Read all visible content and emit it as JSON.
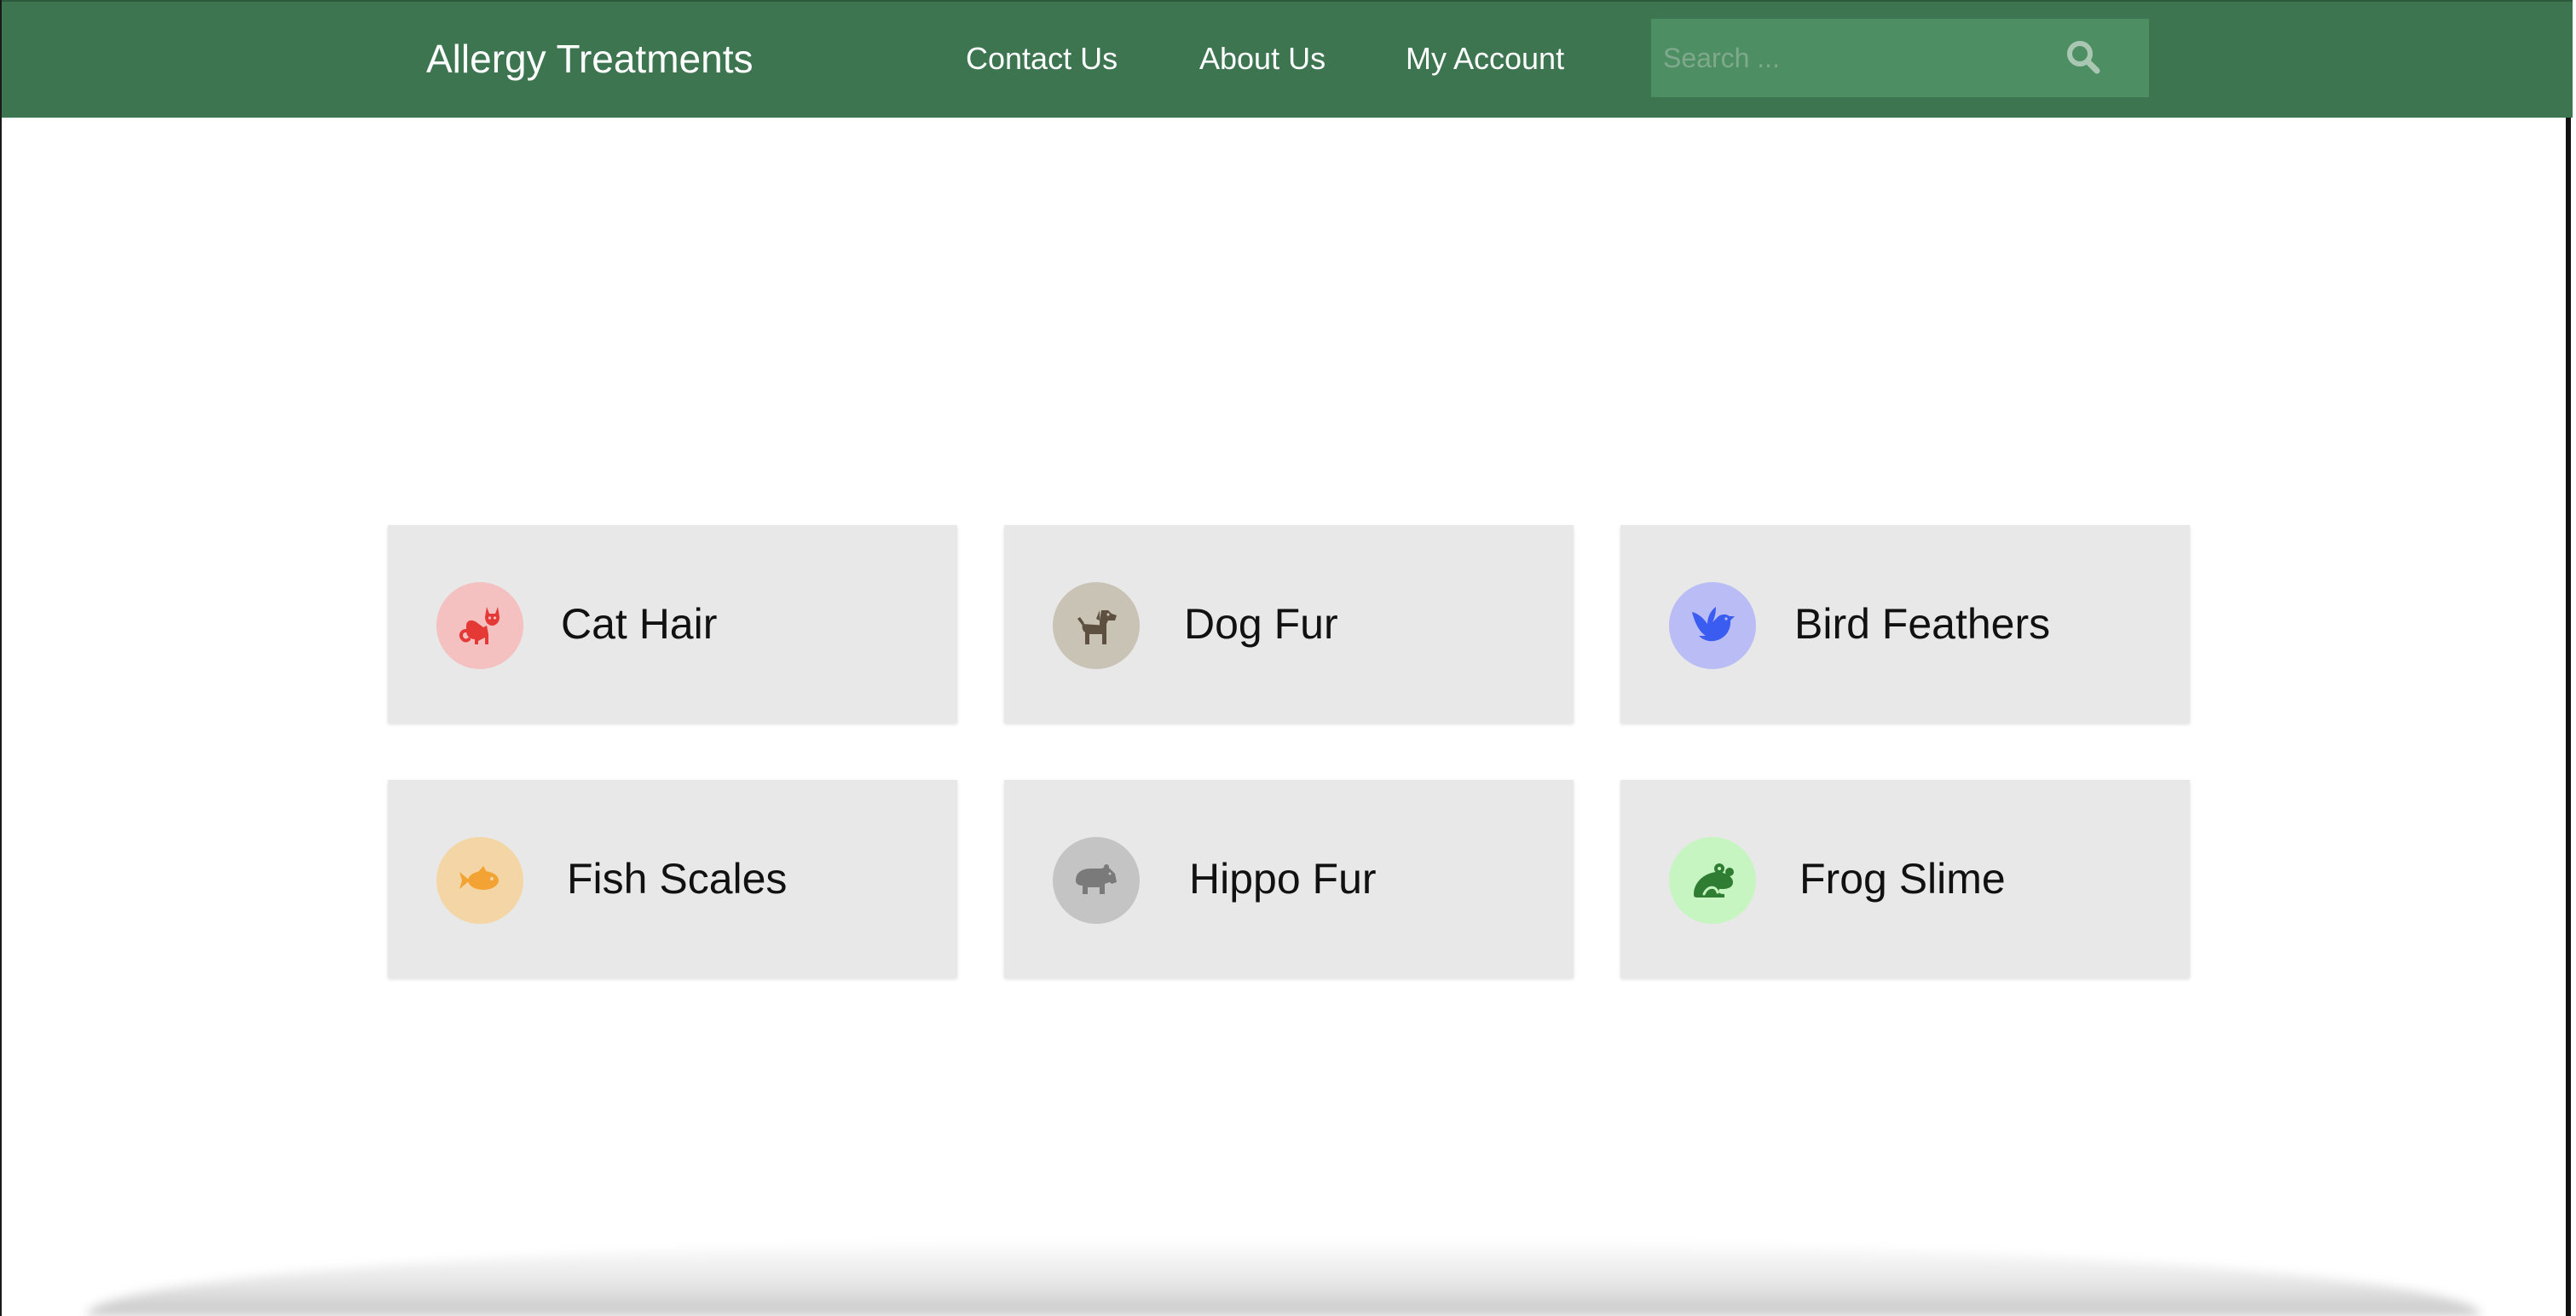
{
  "header": {
    "brand": "Allergy Treatments",
    "nav": {
      "contact": "Contact Us",
      "about": "About Us",
      "account": "My Account"
    },
    "search": {
      "placeholder": "Search ..."
    }
  },
  "colors": {
    "navbar": "#3d7550",
    "search_box": "#4e8e63",
    "card_bg": "#e8e8e8"
  },
  "cards": [
    {
      "label": "Cat Hair",
      "icon": "cat-icon",
      "icon_color": "#e53935",
      "icon_bg": "#f4c0c0"
    },
    {
      "label": "Dog Fur",
      "icon": "dog-icon",
      "icon_color": "#5d5040",
      "icon_bg": "#c9c3b5"
    },
    {
      "label": "Bird Feathers",
      "icon": "bird-icon",
      "icon_color": "#3a5cf0",
      "icon_bg": "#b9bcf5"
    },
    {
      "label": "Fish Scales",
      "icon": "fish-icon",
      "icon_color": "#f2a333",
      "icon_bg": "#f4d6a6"
    },
    {
      "label": "Hippo Fur",
      "icon": "hippo-icon",
      "icon_color": "#7a7a7a",
      "icon_bg": "#c4c4c4"
    },
    {
      "label": "Frog Slime",
      "icon": "frog-icon",
      "icon_color": "#2e7d32",
      "icon_bg": "#c7f5c1"
    }
  ]
}
